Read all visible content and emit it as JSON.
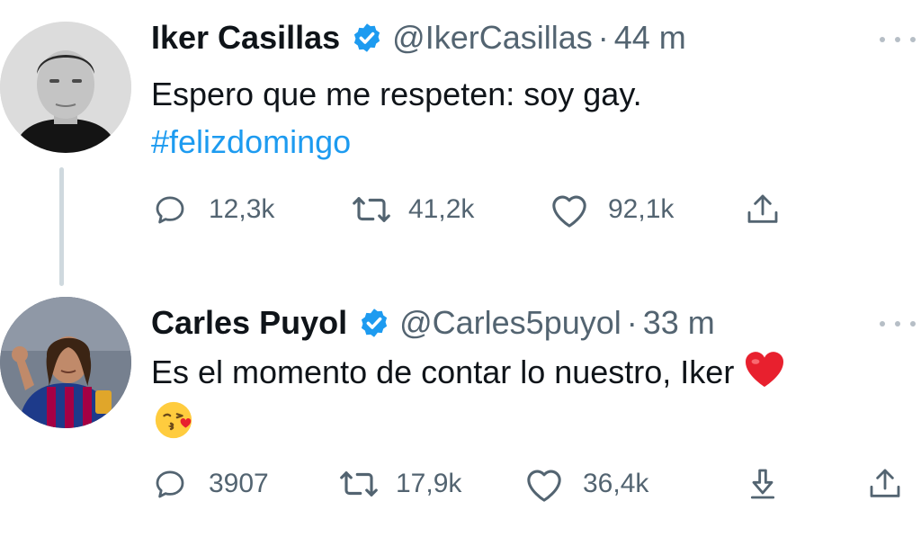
{
  "tweets": [
    {
      "name": "Iker Casillas",
      "handle": "@IkerCasillas",
      "separator": "·",
      "time": "44 m",
      "text_line1": "Espero que me respeten: soy gay.",
      "text_line2": "#felizdomingo",
      "replies": "12,3k",
      "retweets": "41,2k",
      "likes": "92,1k"
    },
    {
      "name": "Carles Puyol",
      "handle": "@Carles5puyol",
      "separator": "·",
      "time": "33 m",
      "text_line1": "Es el momento de contar lo nuestro, Iker",
      "replies": "3907",
      "retweets": "17,9k",
      "likes": "36,4k"
    }
  ],
  "icons": {
    "verified": "verified-badge-icon",
    "more": "more-dots-icon",
    "reply": "reply-icon",
    "retweet": "retweet-icon",
    "like": "like-icon",
    "share": "share-icon",
    "download": "download-icon",
    "heart_emoji": "red-heart-emoji",
    "kiss_emoji": "face-blowing-kiss-emoji"
  },
  "colors": {
    "link": "#1d9bf0",
    "secondary_text": "#536471",
    "verified": "#1d9bf0",
    "heart": "#e0245e"
  }
}
